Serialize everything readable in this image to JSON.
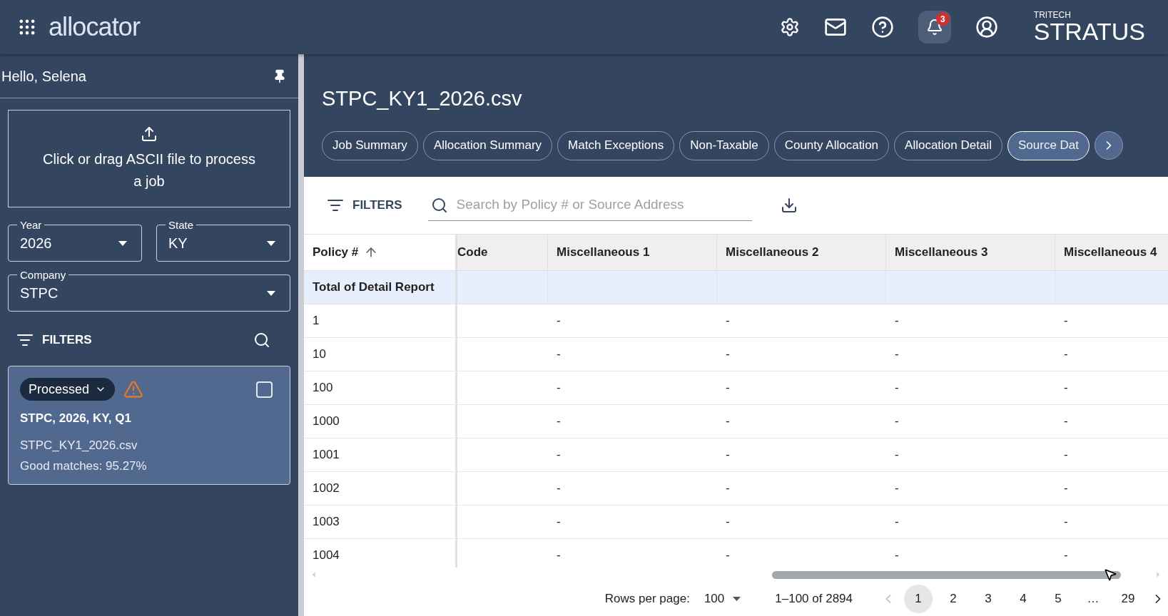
{
  "header": {
    "logo": "allocator",
    "notification_count": "3",
    "brand_small": "TRITECH",
    "brand": "STRATUS"
  },
  "sidebar": {
    "greeting": "Hello, Selena",
    "upload": {
      "text": "Click or drag ASCII file to process a job"
    },
    "fields": [
      {
        "label": "Year",
        "value": "2026"
      },
      {
        "label": "State",
        "value": "KY"
      },
      {
        "label": "Company",
        "value": "STPC"
      }
    ],
    "filters_label": "FILTERS",
    "jobs": [
      {
        "status": "Processed",
        "warning": true,
        "checked": false,
        "title": "STPC, 2026, KY, Q1",
        "file": "STPC_KY1_2026.csv",
        "matches": "Good matches: 95.27%"
      }
    ]
  },
  "main": {
    "title": "STPC_KY1_2026.csv",
    "tabs": [
      {
        "label": "Job Summary",
        "selected": false
      },
      {
        "label": "Allocation Summary",
        "selected": false
      },
      {
        "label": "Match Exceptions",
        "selected": false
      },
      {
        "label": "Non-Taxable",
        "selected": false
      },
      {
        "label": "County Allocation",
        "selected": false
      },
      {
        "label": "Allocation Detail",
        "selected": false
      },
      {
        "label": "Source Dat",
        "selected": true
      }
    ],
    "filters_label": "FILTERS",
    "search": {
      "placeholder": "Search by Policy # or Source Address"
    },
    "table": {
      "columns": [
        "Policy #",
        "Code",
        "Miscellaneous 1",
        "Miscellaneous 2",
        "Miscellaneous 3",
        "Miscellaneous 4"
      ],
      "total_row": "Total of Detail Report",
      "rows": [
        [
          "1",
          "",
          "-",
          "-",
          "-",
          "-"
        ],
        [
          "10",
          "",
          "-",
          "-",
          "-",
          "-"
        ],
        [
          "100",
          "",
          "-",
          "-",
          "-",
          "-"
        ],
        [
          "1000",
          "",
          "-",
          "-",
          "-",
          "-"
        ],
        [
          "1001",
          "",
          "-",
          "-",
          "-",
          "-"
        ],
        [
          "1002",
          "",
          "-",
          "-",
          "-",
          "-"
        ],
        [
          "1003",
          "",
          "-",
          "-",
          "-",
          "-"
        ],
        [
          "1004",
          "",
          "-",
          "-",
          "-",
          "-"
        ]
      ]
    },
    "pagination": {
      "rows_label": "Rows per page:",
      "rows_value": "100",
      "range": "1–100 of 2894",
      "pages": [
        {
          "label": "1",
          "selected": true
        },
        {
          "label": "2",
          "selected": false
        },
        {
          "label": "3",
          "selected": false
        },
        {
          "label": "4",
          "selected": false
        },
        {
          "label": "5",
          "selected": false
        },
        {
          "label": "…",
          "selected": false
        },
        {
          "label": "29",
          "selected": false
        }
      ]
    }
  }
}
